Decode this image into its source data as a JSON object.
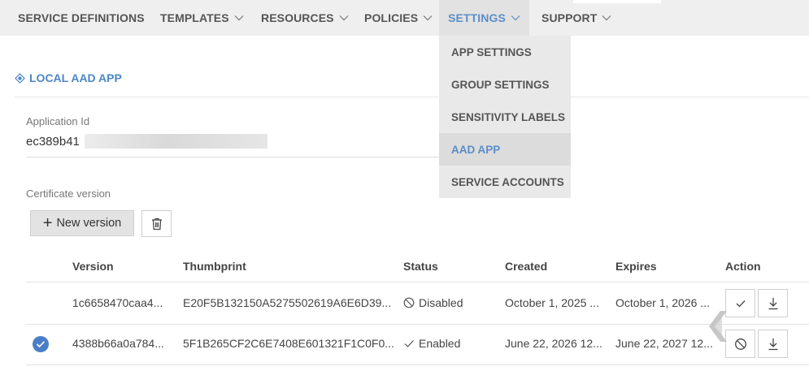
{
  "nav": {
    "items": [
      {
        "label": "SERVICE DEFINITIONS",
        "has_menu": false
      },
      {
        "label": "TEMPLATES",
        "has_menu": true
      },
      {
        "label": "RESOURCES",
        "has_menu": true
      },
      {
        "label": "POLICIES",
        "has_menu": true
      },
      {
        "label": "SETTINGS",
        "has_menu": true,
        "active": true
      },
      {
        "label": "SUPPORT",
        "has_menu": true
      }
    ]
  },
  "settings_menu": {
    "items": [
      {
        "label": "APP SETTINGS"
      },
      {
        "label": "GROUP SETTINGS"
      },
      {
        "label": "SENSITIVITY LABELS"
      },
      {
        "label": "AAD APP",
        "active": true
      },
      {
        "label": "SERVICE ACCOUNTS"
      }
    ]
  },
  "section": {
    "title": "LOCAL AAD APP",
    "icon": "diamond-layers-icon"
  },
  "application": {
    "label": "Application Id",
    "value": "ec389b41"
  },
  "certificate": {
    "label": "Certificate version",
    "new_version_label": "New version",
    "delete_icon": "trash-icon"
  },
  "table": {
    "headers": {
      "version": "Version",
      "thumbprint": "Thumbprint",
      "status": "Status",
      "created": "Created",
      "expires": "Expires",
      "action": "Action"
    },
    "rows": [
      {
        "selected": false,
        "version": "1c6658470caa4...",
        "thumbprint": "E20F5B132150A5275502619A6E6D39...",
        "status": "Disabled",
        "status_icon": "ban-icon",
        "created": "October 1, 2025 ...",
        "expires": "October 1, 2026 ...",
        "actions": [
          "check-icon",
          "download-icon"
        ]
      },
      {
        "selected": true,
        "version": "4388b66a0a784...",
        "thumbprint": "5F1B265CF2C6E7408E601321F1C0F0...",
        "status": "Enabled",
        "status_icon": "check-icon",
        "created": "June 22, 2026 12...",
        "expires": "June 22, 2027 12...",
        "actions": [
          "ban-icon",
          "download-icon"
        ]
      }
    ]
  },
  "colors": {
    "accent": "#4d86c6",
    "nav_bg": "#efefef",
    "menu_bg": "#e9e9e9",
    "selected_circle": "#4a7fc7"
  }
}
